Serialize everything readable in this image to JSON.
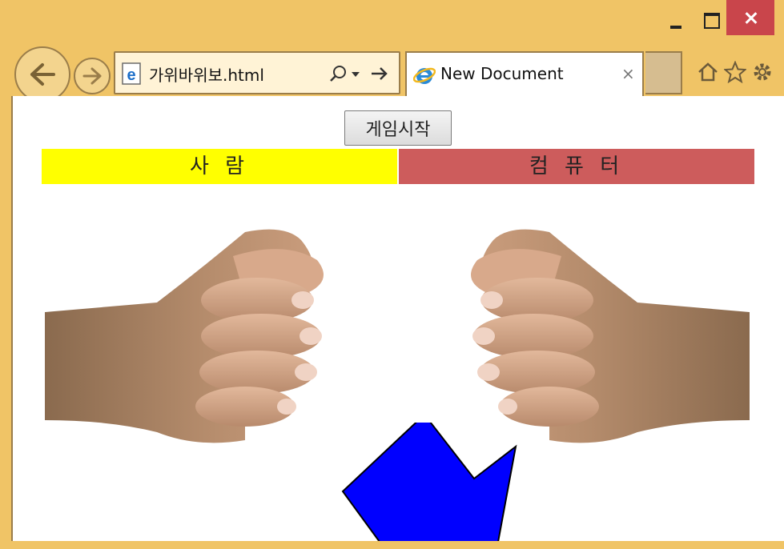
{
  "browser": {
    "address": "가위바위보.html",
    "tab_title": "New Document",
    "tab_close": "×"
  },
  "page": {
    "start_button": "게임시작",
    "human_label": "사 람",
    "computer_label": "컴 퓨 터",
    "human_color": "#ffff00",
    "computer_color": "#cd5c5c",
    "hand_shape": "rock",
    "arrow_color": "#0000ff"
  },
  "icons": [
    "back-icon",
    "forward-icon",
    "page-icon",
    "search-icon",
    "dropdown-icon",
    "go-icon",
    "ie-icon",
    "home-icon",
    "star-icon",
    "gear-icon"
  ]
}
